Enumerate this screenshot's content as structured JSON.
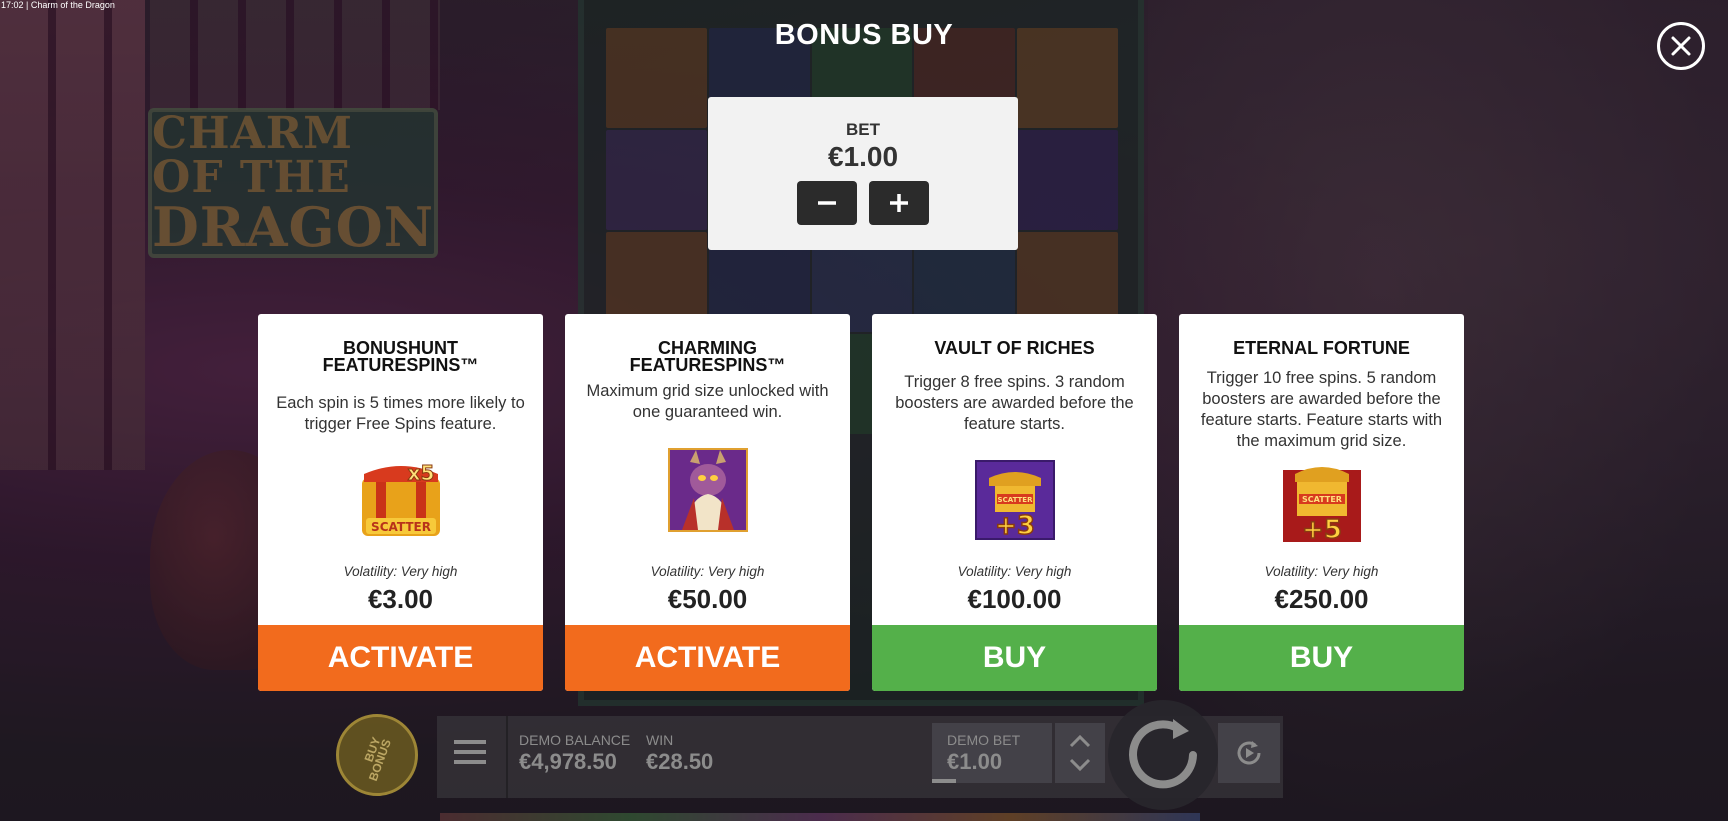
{
  "status_bar": {
    "text": "17:02 | Charm of the Dragon"
  },
  "game": {
    "logo_line1": "CHARM OF THE",
    "logo_line2": "DRAGON"
  },
  "modal": {
    "title": "BONUS BUY",
    "bet": {
      "label": "BET",
      "value": "€1.00",
      "decrease_icon": "minus-icon",
      "increase_icon": "plus-icon"
    },
    "close_icon": "close-icon",
    "cards": [
      {
        "title_line1": "BONUSHUNT",
        "title_line2": "FEATURESPINS™",
        "description": "Each spin is 5 times more likely to trigger Free Spins feature.",
        "icon": "scatter-x5-icon",
        "icon_text": "SCATTER",
        "icon_badge": "x5",
        "volatility": "Volatility: Very high",
        "price": "€3.00",
        "button": "ACTIVATE",
        "button_color": "#f26b1d"
      },
      {
        "title_line1": "CHARMING FEATURESPINS™",
        "title_line2": "",
        "description": "Maximum grid size unlocked with one guaranteed win.",
        "icon": "dragon-character-icon",
        "volatility": "Volatility: Very high",
        "price": "€50.00",
        "button": "ACTIVATE",
        "button_color": "#f26b1d"
      },
      {
        "title_line1": "VAULT OF RICHES",
        "title_line2": "",
        "description": "Trigger 8 free spins. 3 random boosters are awarded before the feature starts.",
        "icon": "scatter-plus3-icon",
        "icon_text": "SCATTER",
        "icon_badge": "+3",
        "volatility": "Volatility: Very high",
        "price": "€100.00",
        "button": "BUY",
        "button_color": "#54b04a"
      },
      {
        "title_line1": "ETERNAL FORTUNE",
        "title_line2": "",
        "description": "Trigger 10 free spins. 5 random boosters are awarded before the feature starts. Feature starts with the maximum grid size.",
        "icon": "scatter-plus5-icon",
        "icon_text": "SCATTER",
        "icon_badge": "+5",
        "volatility": "Volatility: Very high",
        "price": "€250.00",
        "button": "BUY",
        "button_color": "#54b04a"
      }
    ]
  },
  "game_bar": {
    "buy_bonus_line1": "BUY",
    "buy_bonus_line2": "BONUS",
    "menu_icon": "hamburger-menu-icon",
    "demo_balance_label": "DEMO BALANCE",
    "demo_balance_value": "€4,978.50",
    "win_label": "WIN",
    "win_value": "€28.50",
    "demo_bet_label": "DEMO BET",
    "demo_bet_value": "€1.00",
    "spin_icon": "spin-icon",
    "autoplay_icon": "autoplay-icon"
  }
}
